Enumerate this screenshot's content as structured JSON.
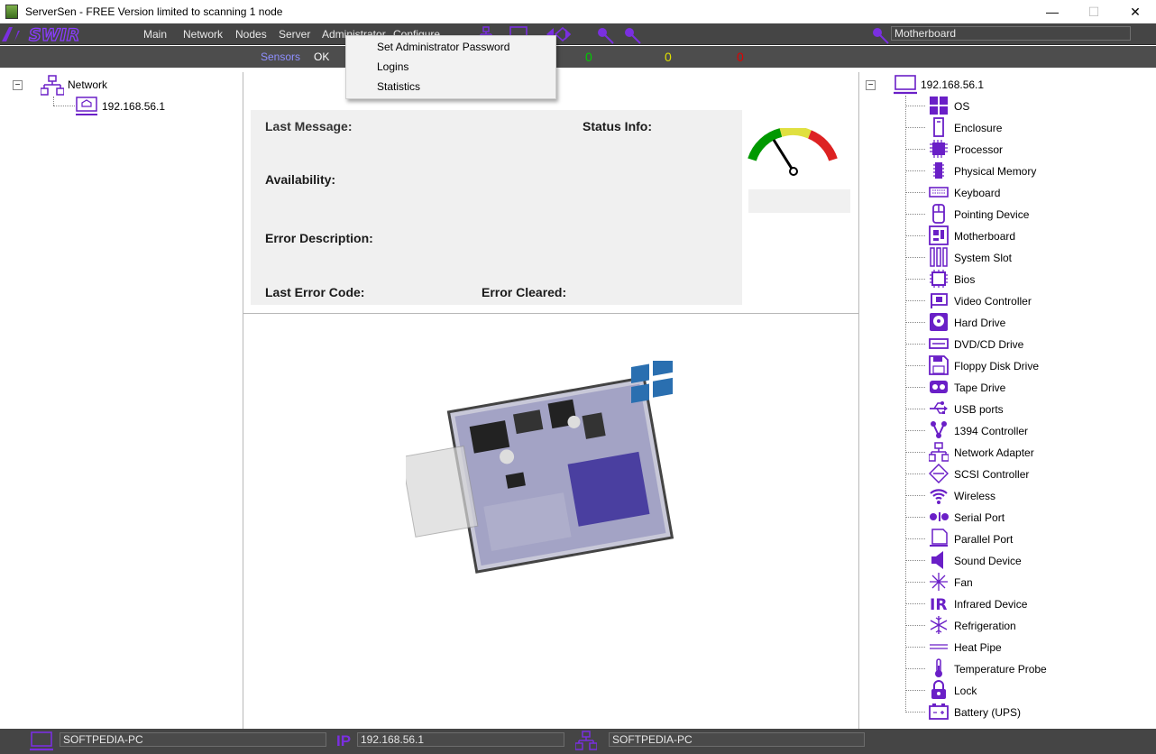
{
  "window": {
    "title": "ServerSen - FREE Version limited to scanning 1 node",
    "minimize": "—",
    "maximize": "☐",
    "close": "✕"
  },
  "menu": {
    "items": [
      "Main",
      "Network",
      "Nodes",
      "Server",
      "Administrator",
      "Configure"
    ],
    "search_value": "Motherboard"
  },
  "sensors": {
    "label": "Sensors",
    "status": "OK",
    "counts": [
      {
        "value": "0",
        "color": "#00cc00"
      },
      {
        "value": "0",
        "color": "#e0e000"
      },
      {
        "value": "0",
        "color": "#e00000"
      }
    ]
  },
  "dropdown": {
    "items": [
      "Set Administrator Password",
      "Logins",
      "Statistics"
    ]
  },
  "left_tree": {
    "root": "Network",
    "child": "192.168.56.1"
  },
  "info": {
    "last_message": "Last Message:",
    "status_info": "Status Info:",
    "availability": "Availability:",
    "error_description": "Error Description:",
    "last_error_code": "Last Error Code:",
    "error_cleared": "Error Cleared:"
  },
  "gauge": {
    "colors": [
      "#009900",
      "#e0e040",
      "#dd2222"
    ]
  },
  "right_tree": {
    "root": "192.168.56.1",
    "items": [
      {
        "label": "OS",
        "icon": "windows-icon"
      },
      {
        "label": "Enclosure",
        "icon": "enclosure-icon"
      },
      {
        "label": "Processor",
        "icon": "processor-icon"
      },
      {
        "label": "Physical Memory",
        "icon": "memory-icon"
      },
      {
        "label": "Keyboard",
        "icon": "keyboard-icon"
      },
      {
        "label": "Pointing Device",
        "icon": "mouse-icon"
      },
      {
        "label": "Motherboard",
        "icon": "motherboard-icon"
      },
      {
        "label": "System Slot",
        "icon": "system-slot-icon"
      },
      {
        "label": "Bios",
        "icon": "bios-icon"
      },
      {
        "label": "Video Controller",
        "icon": "video-controller-icon"
      },
      {
        "label": "Hard Drive",
        "icon": "hard-drive-icon"
      },
      {
        "label": "DVD/CD Drive",
        "icon": "dvd-drive-icon"
      },
      {
        "label": "Floppy Disk Drive",
        "icon": "floppy-icon"
      },
      {
        "label": "Tape Drive",
        "icon": "tape-drive-icon"
      },
      {
        "label": "USB ports",
        "icon": "usb-icon"
      },
      {
        "label": "1394 Controller",
        "icon": "firewire-icon"
      },
      {
        "label": "Network Adapter",
        "icon": "network-adapter-icon"
      },
      {
        "label": "SCSI Controller",
        "icon": "scsi-icon"
      },
      {
        "label": "Wireless",
        "icon": "wireless-icon"
      },
      {
        "label": "Serial Port",
        "icon": "serial-port-icon"
      },
      {
        "label": "Parallel Port",
        "icon": "parallel-port-icon"
      },
      {
        "label": "Sound Device",
        "icon": "speaker-icon"
      },
      {
        "label": "Fan",
        "icon": "fan-icon"
      },
      {
        "label": "Infrared Device",
        "icon": "infrared-icon"
      },
      {
        "label": "Refrigeration",
        "icon": "snowflake-icon"
      },
      {
        "label": "Heat Pipe",
        "icon": "heat-pipe-icon"
      },
      {
        "label": "Temperature Probe",
        "icon": "thermometer-icon"
      },
      {
        "label": "Lock",
        "icon": "lock-icon"
      },
      {
        "label": "Battery (UPS)",
        "icon": "battery-icon"
      }
    ]
  },
  "status": {
    "computer_name": "SOFTPEDIA-PC",
    "ip_label": "IP",
    "ip": "192.168.56.1",
    "domain": "SOFTPEDIA-PC"
  },
  "accent": "#6a1fc7"
}
